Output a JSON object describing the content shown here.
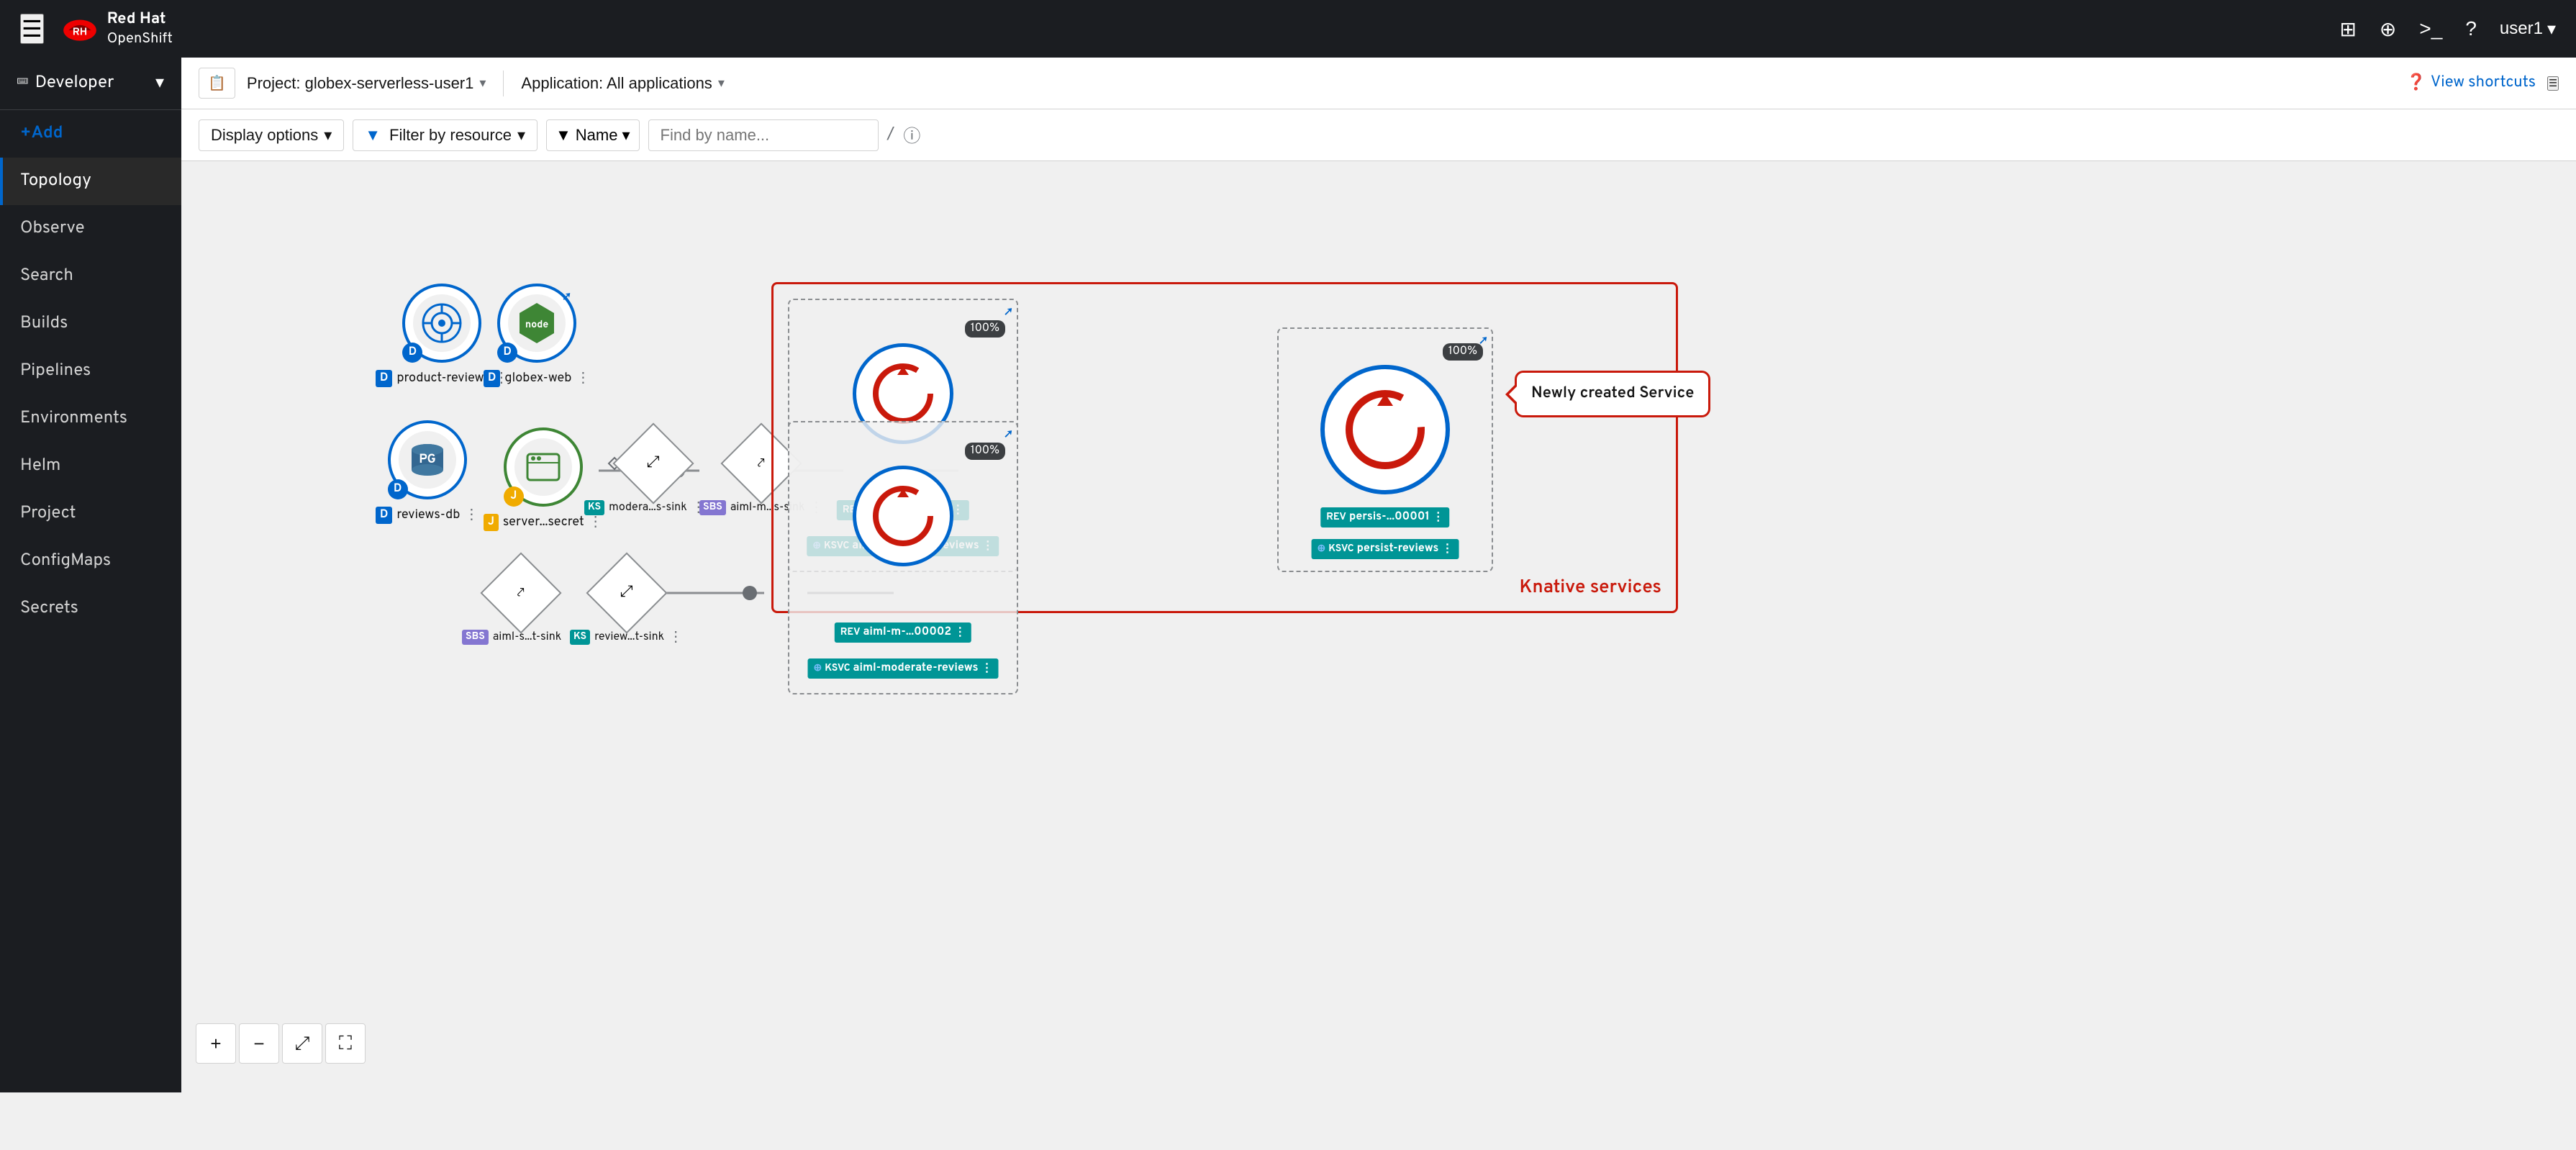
{
  "topnav": {
    "brand": "Red Hat",
    "product": "OpenShift",
    "user": "user1",
    "icons": [
      "grid-icon",
      "plus-icon",
      "terminal-icon",
      "help-icon"
    ]
  },
  "sidebar": {
    "role": "Developer",
    "items": [
      {
        "id": "add",
        "label": "+Add"
      },
      {
        "id": "topology",
        "label": "Topology",
        "active": true
      },
      {
        "id": "observe",
        "label": "Observe"
      },
      {
        "id": "search",
        "label": "Search"
      },
      {
        "id": "builds",
        "label": "Builds"
      },
      {
        "id": "pipelines",
        "label": "Pipelines"
      },
      {
        "id": "environments",
        "label": "Environments"
      },
      {
        "id": "helm",
        "label": "Helm"
      },
      {
        "id": "project",
        "label": "Project"
      },
      {
        "id": "configmaps",
        "label": "ConfigMaps"
      },
      {
        "id": "secrets",
        "label": "Secrets"
      }
    ]
  },
  "secondary_nav": {
    "project_label": "Project: globex-serverless-user1",
    "app_label": "Application: All applications",
    "view_shortcuts": "View shortcuts"
  },
  "toolbar": {
    "display_options": "Display options",
    "filter_by_resource": "Filter by resource",
    "name_label": "Name",
    "search_placeholder": "Find by name...",
    "slash": "/"
  },
  "topology": {
    "nodes": [
      {
        "id": "product-reviews",
        "label": "product-reviews",
        "badge": "D",
        "type": "deployment"
      },
      {
        "id": "globex-web",
        "label": "globex-web",
        "badge": "D",
        "type": "nodejs"
      },
      {
        "id": "reviews-db",
        "label": "reviews-db",
        "badge": "D",
        "type": "postgres"
      },
      {
        "id": "server-secret",
        "label": "server...secret",
        "badge": "J",
        "type": "secret"
      },
      {
        "id": "modera-s-sink",
        "label": "modera...s-sink",
        "badge": "KS",
        "type": "kafkasource"
      },
      {
        "id": "aiml-m-s-sink",
        "label": "aiml-m...s-sink",
        "badge": "SBS",
        "type": "sbs"
      },
      {
        "id": "aiml-s-t-sink",
        "label": "aiml-s...t-sink",
        "badge": "SBS",
        "type": "sbs"
      },
      {
        "id": "review-t-sink",
        "label": "review...t-sink",
        "badge": "KS",
        "type": "kafkasink"
      }
    ],
    "knative_group": {
      "label": "Knative services",
      "services": [
        {
          "id": "aiml-sentiment-reviews",
          "ksvc_label": "aiml-sentiment-reviews",
          "rev_label": "aiml-s-...00002",
          "pct": "100%"
        },
        {
          "id": "aiml-moderate-reviews",
          "ksvc_label": "aiml-moderate-reviews",
          "rev_label": "aiml-m-...00002",
          "pct": "100%"
        },
        {
          "id": "persist-reviews",
          "ksvc_label": "persist-reviews",
          "rev_label": "persis-...00001",
          "pct": "100%"
        }
      ],
      "callout": "Newly created Service"
    }
  },
  "zoom": {
    "zoom_in": "+",
    "zoom_out": "−",
    "fit": "⤢",
    "expand": "⛶"
  }
}
